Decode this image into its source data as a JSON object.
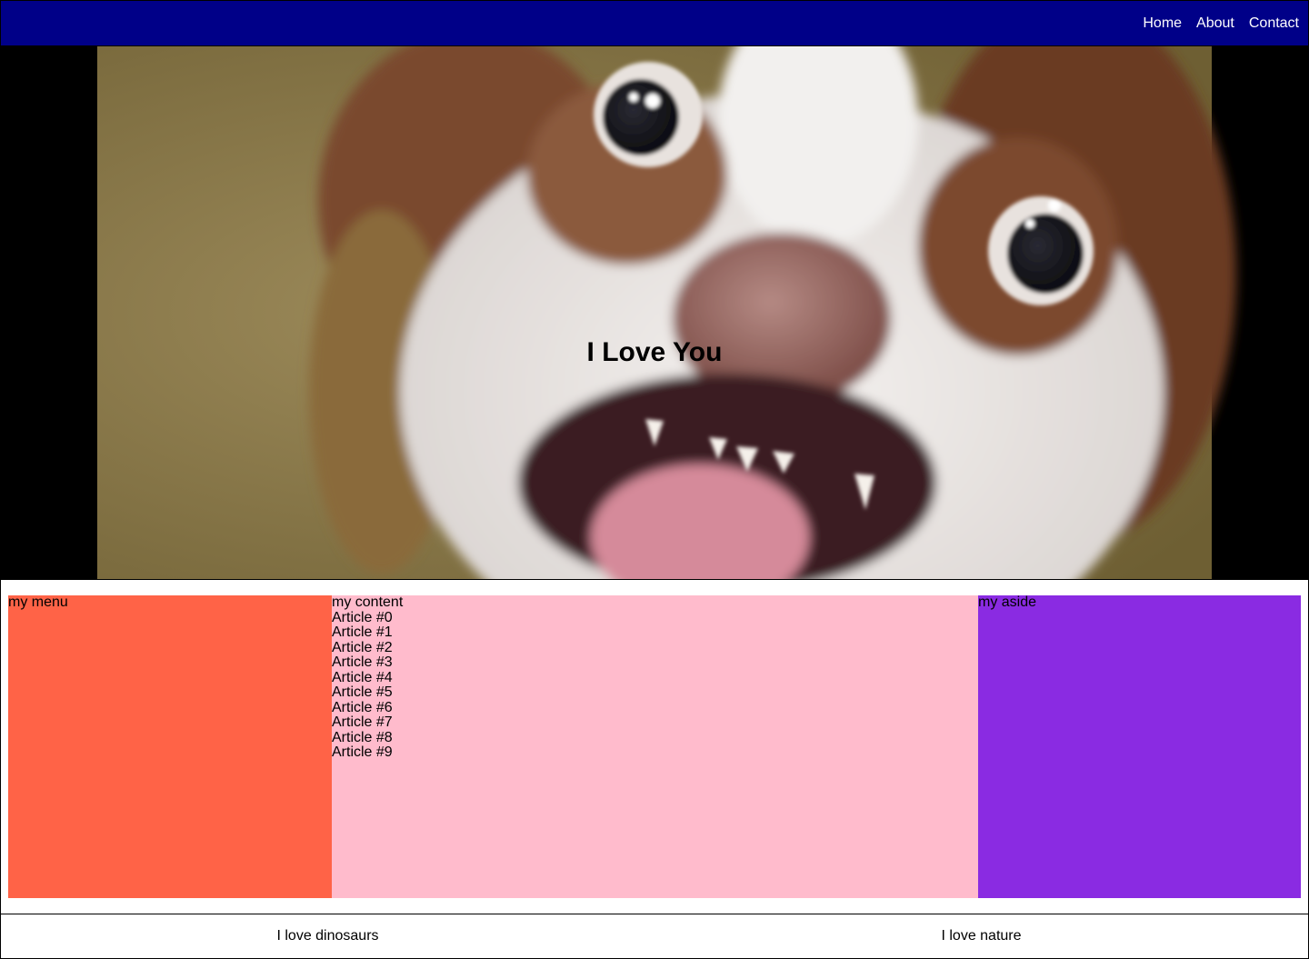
{
  "nav": {
    "links": [
      "Home",
      "About",
      "Contact"
    ]
  },
  "hero": {
    "title": "I Love You",
    "image": "dog-photo"
  },
  "main": {
    "menu_label": "my menu",
    "content_label": "my content",
    "articles": [
      "Article #0",
      "Article #1",
      "Article #2",
      "Article #3",
      "Article #4",
      "Article #5",
      "Article #6",
      "Article #7",
      "Article #8",
      "Article #9"
    ],
    "aside_label": "my aside"
  },
  "footer": {
    "left": "I love dinosaurs",
    "right": "I love nature"
  },
  "colors": {
    "nav_bg": "#000088",
    "menu_bg": "#ff6347",
    "content_bg": "#ffbbcc",
    "aside_bg": "#8a2be2"
  }
}
